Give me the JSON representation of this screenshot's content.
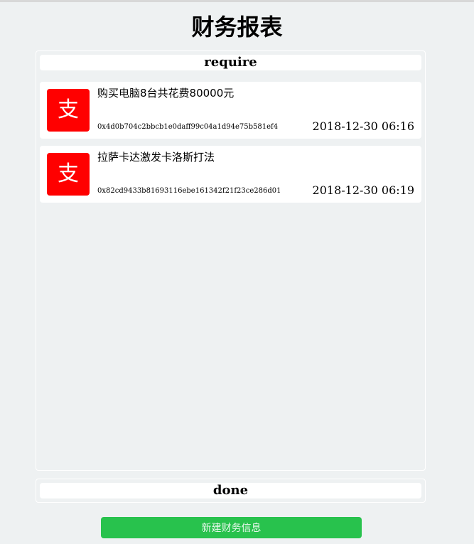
{
  "page": {
    "title": "财务报表"
  },
  "sections": {
    "require": {
      "header": "require",
      "items": [
        {
          "badge": "支",
          "title": "购买电脑8台共花费80000元",
          "hash": "0x4d0b704c2bbcb1e0daff99c04a1d94e75b581ef4",
          "time": "2018-12-30 06:16"
        },
        {
          "badge": "支",
          "title": "拉萨卡达激发卡洛斯打法",
          "hash": "0x82cd9433b81693116ebe161342f21f23ce286d01",
          "time": "2018-12-30 06:19"
        }
      ]
    },
    "done": {
      "header": "done"
    }
  },
  "actions": {
    "new_label": "新建财务信息"
  },
  "colors": {
    "badge_bg": "#ff0000",
    "button_bg": "#28c24d",
    "page_bg": "#eef1f2"
  }
}
